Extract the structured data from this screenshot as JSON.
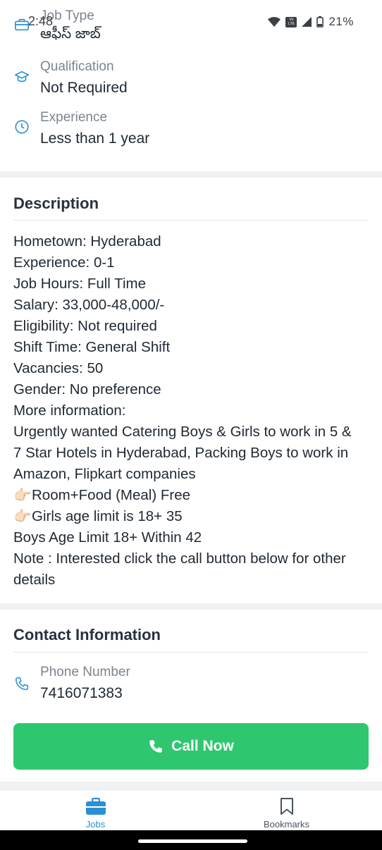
{
  "status_bar": {
    "time": "2:48",
    "volte": "Vo LTE",
    "battery_percent": "21%"
  },
  "details": {
    "job_type": {
      "label": "Job Type",
      "value": "ఆఫీస్ జాబ్",
      "icon": "briefcase-icon"
    },
    "qualification": {
      "label": "Qualification",
      "value": "Not Required",
      "icon": "graduation-cap-icon"
    },
    "experience": {
      "label": "Experience",
      "value": "Less than 1 year",
      "icon": "clock-icon"
    }
  },
  "description": {
    "title": "Description",
    "lines": [
      "Hometown: Hyderabad",
      "Experience: 0-1",
      "Job Hours: Full Time",
      "Salary: 33,000-48,000/-",
      "Eligibility: Not required",
      "Shift Time: General Shift",
      "Vacancies: 50",
      "Gender: No preference",
      "More information:",
      "Urgently wanted Catering Boys & Girls to work in 5 &",
      "7 Star Hotels in Hyderabad, Packing Boys to work in",
      "Amazon, Flipkart companies",
      "Room+Food (Meal) Free",
      "Girls age limit is 18+ 35",
      "Boys Age Limit 18+ Within 42",
      "Note : Interested click the call button below for other",
      "details"
    ],
    "pointer_emoji": "👉🏻"
  },
  "contact": {
    "title": "Contact Information",
    "phone_label": "Phone Number",
    "phone_value": "7416071383",
    "call_button": "Call Now"
  },
  "bottom_nav": {
    "jobs": "Jobs",
    "bookmarks": "Bookmarks"
  },
  "colors": {
    "accent_blue": "#2b8fd6",
    "call_green": "#2ec76f",
    "label_grey": "#7b848e"
  }
}
